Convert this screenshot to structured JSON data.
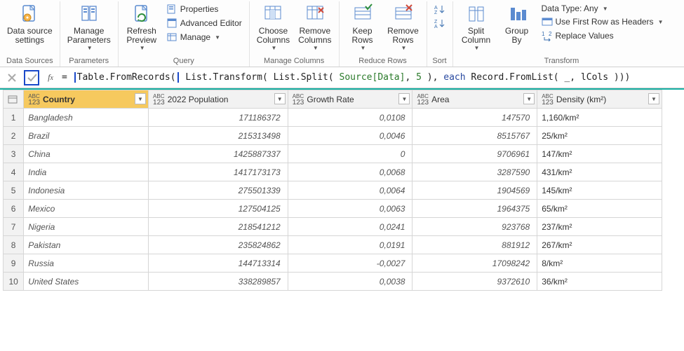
{
  "ribbon": {
    "groups": {
      "data_sources": {
        "label": "Data Sources",
        "data_source_settings": "Data source\nsettings"
      },
      "parameters": {
        "label": "Parameters",
        "manage_parameters": "Manage\nParameters"
      },
      "query": {
        "label": "Query",
        "refresh_preview": "Refresh\nPreview",
        "properties": "Properties",
        "advanced_editor": "Advanced Editor",
        "manage": "Manage"
      },
      "manage_columns": {
        "label": "Manage Columns",
        "choose_columns": "Choose\nColumns",
        "remove_columns": "Remove\nColumns"
      },
      "reduce_rows": {
        "label": "Reduce Rows",
        "keep_rows": "Keep\nRows",
        "remove_rows": "Remove\nRows"
      },
      "sort": {
        "label": "Sort"
      },
      "transform": {
        "label": "Transform",
        "split_column": "Split\nColumn",
        "group_by": "Group\nBy",
        "data_type": "Data Type: Any",
        "first_row_headers": "Use First Row as Headers",
        "replace_values": "Replace Values"
      }
    }
  },
  "formula": {
    "prefix_eq": "= ",
    "highlight": "Table.FromRecords(",
    "rest_a": " List.Transform( List.Split( ",
    "arg1": "Source[Data]",
    "rest_b": ", ",
    "arg2": "5",
    "rest_c": " ), ",
    "kw": "each",
    "rest_d": " Record.FromList( _, lCols )))"
  },
  "columns": [
    "Country",
    "2022 Population",
    "Growth Rate",
    "Area",
    "Density (km²)"
  ],
  "rows": [
    {
      "n": "1",
      "country": "Bangladesh",
      "pop": "171186372",
      "growth": "0,0108",
      "area": "147570",
      "density": "1,160/km²"
    },
    {
      "n": "2",
      "country": "Brazil",
      "pop": "215313498",
      "growth": "0,0046",
      "area": "8515767",
      "density": "25/km²"
    },
    {
      "n": "3",
      "country": "China",
      "pop": "1425887337",
      "growth": "0",
      "area": "9706961",
      "density": "147/km²"
    },
    {
      "n": "4",
      "country": "India",
      "pop": "1417173173",
      "growth": "0,0068",
      "area": "3287590",
      "density": "431/km²"
    },
    {
      "n": "5",
      "country": "Indonesia",
      "pop": "275501339",
      "growth": "0,0064",
      "area": "1904569",
      "density": "145/km²"
    },
    {
      "n": "6",
      "country": "Mexico",
      "pop": "127504125",
      "growth": "0,0063",
      "area": "1964375",
      "density": "65/km²"
    },
    {
      "n": "7",
      "country": "Nigeria",
      "pop": "218541212",
      "growth": "0,0241",
      "area": "923768",
      "density": "237/km²"
    },
    {
      "n": "8",
      "country": "Pakistan",
      "pop": "235824862",
      "growth": "0,0191",
      "area": "881912",
      "density": "267/km²"
    },
    {
      "n": "9",
      "country": "Russia",
      "pop": "144713314",
      "growth": "-0,0027",
      "area": "17098242",
      "density": "8/km²"
    },
    {
      "n": "10",
      "country": "United States",
      "pop": "338289857",
      "growth": "0,0038",
      "area": "9372610",
      "density": "36/km²"
    }
  ]
}
